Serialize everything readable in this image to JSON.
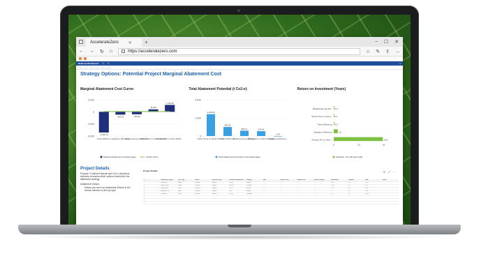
{
  "browser": {
    "tab_title": "AccelerateZero",
    "url": "https://acceleratezero.com"
  },
  "app": {
    "brand": "Bellevue Dashboard",
    "page_title": "Strategy Options: Potential Project Marginal Abatement Cost"
  },
  "charts": {
    "macc": {
      "title": "Marginal Abatement Cost Curve:",
      "legend": [
        "Marginal Abatement Cost(Average)",
        "Carbon Price"
      ]
    },
    "abatement": {
      "title": "Total Abatement Potential (t Co2-e):",
      "legend": [
        "Total Abatement Potential (t Co2-e)(Average)"
      ]
    },
    "roi": {
      "title": "Return on Investment (Years)",
      "legend": [
        "Payback - Pre (30 year total)"
      ]
    }
  },
  "chart_data": [
    {
      "type": "bar",
      "title": "Marginal Abatement Cost Curve:",
      "categories": [
        "Travel Efficiency",
        "Appliance Efficiency",
        "Building Energy Efficiency",
        "Switch Fleet to Hybrid Vehicles",
        "Rooftop PV on Admin Building"
      ],
      "series": [
        {
          "name": "Marginal Abatement Cost(Average)",
          "values": [
            -3419.75,
            -463.53,
            -403.29,
            414.83,
            1145.08
          ],
          "color": "#1f2f7a"
        },
        {
          "name": "Carbon Price",
          "values": [
            60,
            60,
            60,
            60,
            60
          ],
          "color": "#7cc142"
        }
      ],
      "ytick_labels": [
        "2,000",
        "0",
        "-2,000",
        "-4,000"
      ],
      "ylim": [
        -4000,
        2000
      ]
    },
    {
      "type": "bar",
      "title": "Total Abatement Potential (t Co2-e):",
      "categories": [
        "Switch Fleet to Hybrid Vehicles",
        "Travel Efficiency",
        "Building Energy Efficiency",
        "Rooftop PV on Admin Building",
        "Appliance Efficiency"
      ],
      "series": [
        {
          "name": "Total Abatement Potential (t Co2-e)(Average)",
          "values": [
            2409.9,
            995.34,
            590.71,
            534.33,
            1.44
          ],
          "color": "#3aa0e0"
        }
      ],
      "ytick_labels": [
        "4,000",
        "2,000",
        "0"
      ],
      "ylim": [
        0,
        4000
      ]
    },
    {
      "type": "bar",
      "title": "Return on Investment (Years)",
      "orientation": "horizontal",
      "categories": [
        "Building Energy Eff...",
        "Switch Fleet to Hybri...",
        "Travel Efficiency",
        "Appliance Efficiency",
        "Rooftop PV on Admi..."
      ],
      "series": [
        {
          "name": "Payback - Pre (30 year total)",
          "values": [
            0.0,
            0.0,
            0.0,
            1.6,
            19.6
          ],
          "color": "#7cc142"
        }
      ],
      "xtick_labels": [
        "0",
        "10",
        "20"
      ],
      "xlim": [
        0,
        24
      ]
    }
  ],
  "project_details": {
    "title": "Project Details",
    "purpose": "Purpose: Combine financial and Co2-e reductions elements to assess which options should form the abatement strategy.",
    "version_label": "Abatement Version:",
    "bullet": "Ensure you are in an abatement Version in the version selector on the top right",
    "table_title": "Project Details",
    "columns": [
      "#",
      "Abatement Option",
      "Cost Type",
      "Status",
      "Emission Type",
      "Calculated Abatement",
      "Category",
      "Rate",
      "Upfront Cost",
      "Annual Cost",
      "Annual Saving",
      "Abatement",
      "Payback",
      "MAC",
      "Notes"
    ],
    "rows": [
      [
        "1",
        "Rooftop PV",
        "Capex",
        "Planned",
        "Scope 2",
        "534.33",
        "Energy",
        "—",
        "—",
        "—",
        "—",
        "534",
        "19.6",
        "1145",
        ""
      ],
      [
        "2",
        "Switch Fleet",
        "Capex",
        "Planned",
        "Scope 1",
        "2409.90",
        "Transport",
        "—",
        "—",
        "—",
        "—",
        "2410",
        "0.0",
        "415",
        ""
      ],
      [
        "3",
        "Building EE",
        "Opex",
        "Planned",
        "Scope 2",
        "590.71",
        "Energy",
        "—",
        "—",
        "—",
        "—",
        "591",
        "0.0",
        "-403",
        ""
      ],
      [
        "4",
        "Appliance Eff.",
        "Opex",
        "Planned",
        "Scope 2",
        "1.44",
        "Energy",
        "—",
        "—",
        "—",
        "—",
        "1",
        "1.6",
        "-464",
        ""
      ],
      [
        "5",
        "Travel Eff.",
        "Opex",
        "Planned",
        "Scope 3",
        "995.34",
        "Transport",
        "—",
        "—",
        "—",
        "—",
        "995",
        "0.0",
        "-3420",
        ""
      ],
      [
        "6",
        "",
        "",
        "",
        "",
        "",
        "",
        "",
        "",
        "",
        "",
        "",
        "",
        "",
        ""
      ],
      [
        "7",
        "",
        "",
        "",
        "",
        "",
        "",
        "",
        "",
        "",
        "",
        "",
        "",
        "",
        ""
      ],
      [
        "8",
        "",
        "",
        "",
        "",
        "",
        "",
        "",
        "",
        "",
        "",
        "",
        "",
        "",
        ""
      ]
    ]
  }
}
